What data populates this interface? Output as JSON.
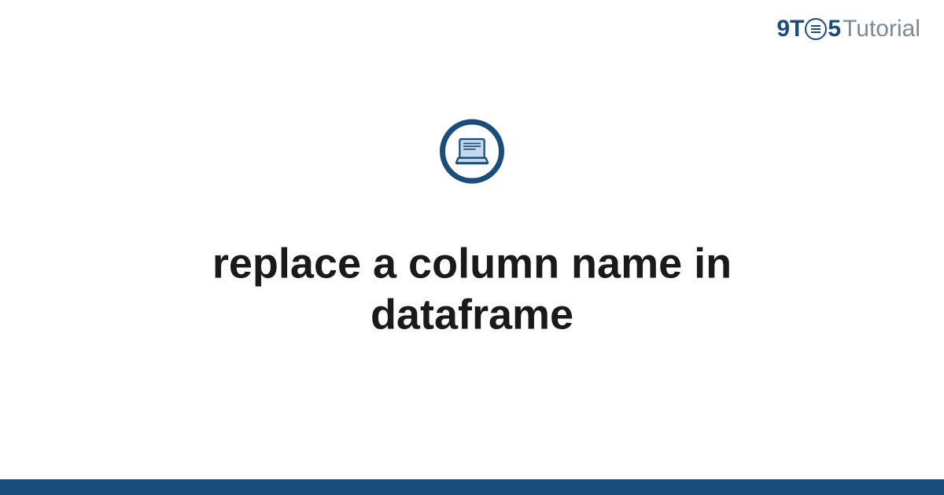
{
  "logo": {
    "part1": "9T",
    "part2": "5",
    "part3": "Tutorial"
  },
  "title": "replace a column name in dataframe",
  "colors": {
    "primary": "#1a4d7a",
    "secondary": "#7a8a9a",
    "laptop_fill": "#c5d8ee"
  }
}
